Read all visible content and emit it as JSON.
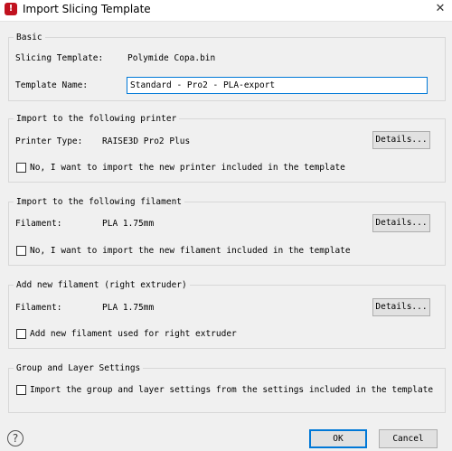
{
  "window": {
    "title": "Import Slicing Template",
    "app_icon": "raise3d-logo-icon",
    "close_glyph": "✕"
  },
  "basic": {
    "legend": "Basic",
    "slicing_template_label": "Slicing Template:",
    "slicing_template_value": "Polymide Copa.bin",
    "template_name_label": "Template Name:",
    "template_name_value": "Standard - Pro2 - PLA-export"
  },
  "printer": {
    "legend": "Import to the following printer",
    "type_label": "Printer Type:",
    "type_value": "RAISE3D Pro2 Plus",
    "details_label": "Details...",
    "checkbox_label": "No, I want to import the new printer included in the template",
    "checked": false
  },
  "filament": {
    "legend": "Import to the following filament",
    "label": "Filament:",
    "value": "PLA 1.75mm",
    "details_label": "Details...",
    "checkbox_label": "No, I want to import the new filament included in the template",
    "checked": false
  },
  "right_extruder": {
    "legend": "Add new filament (right extruder)",
    "label": "Filament:",
    "value": "PLA 1.75mm",
    "details_label": "Details...",
    "checkbox_label": "Add new filament used for right extruder",
    "checked": false
  },
  "group_layer": {
    "legend": "Group and Layer Settings",
    "checkbox_label": "Import the group and layer settings from the settings included in the template",
    "checked": false
  },
  "footer": {
    "help_glyph": "?",
    "ok_label": "OK",
    "cancel_label": "Cancel"
  },
  "colors": {
    "accent": "#0078d7",
    "dialog_bg": "#f0f0f0",
    "app_icon": "#c1121f"
  }
}
